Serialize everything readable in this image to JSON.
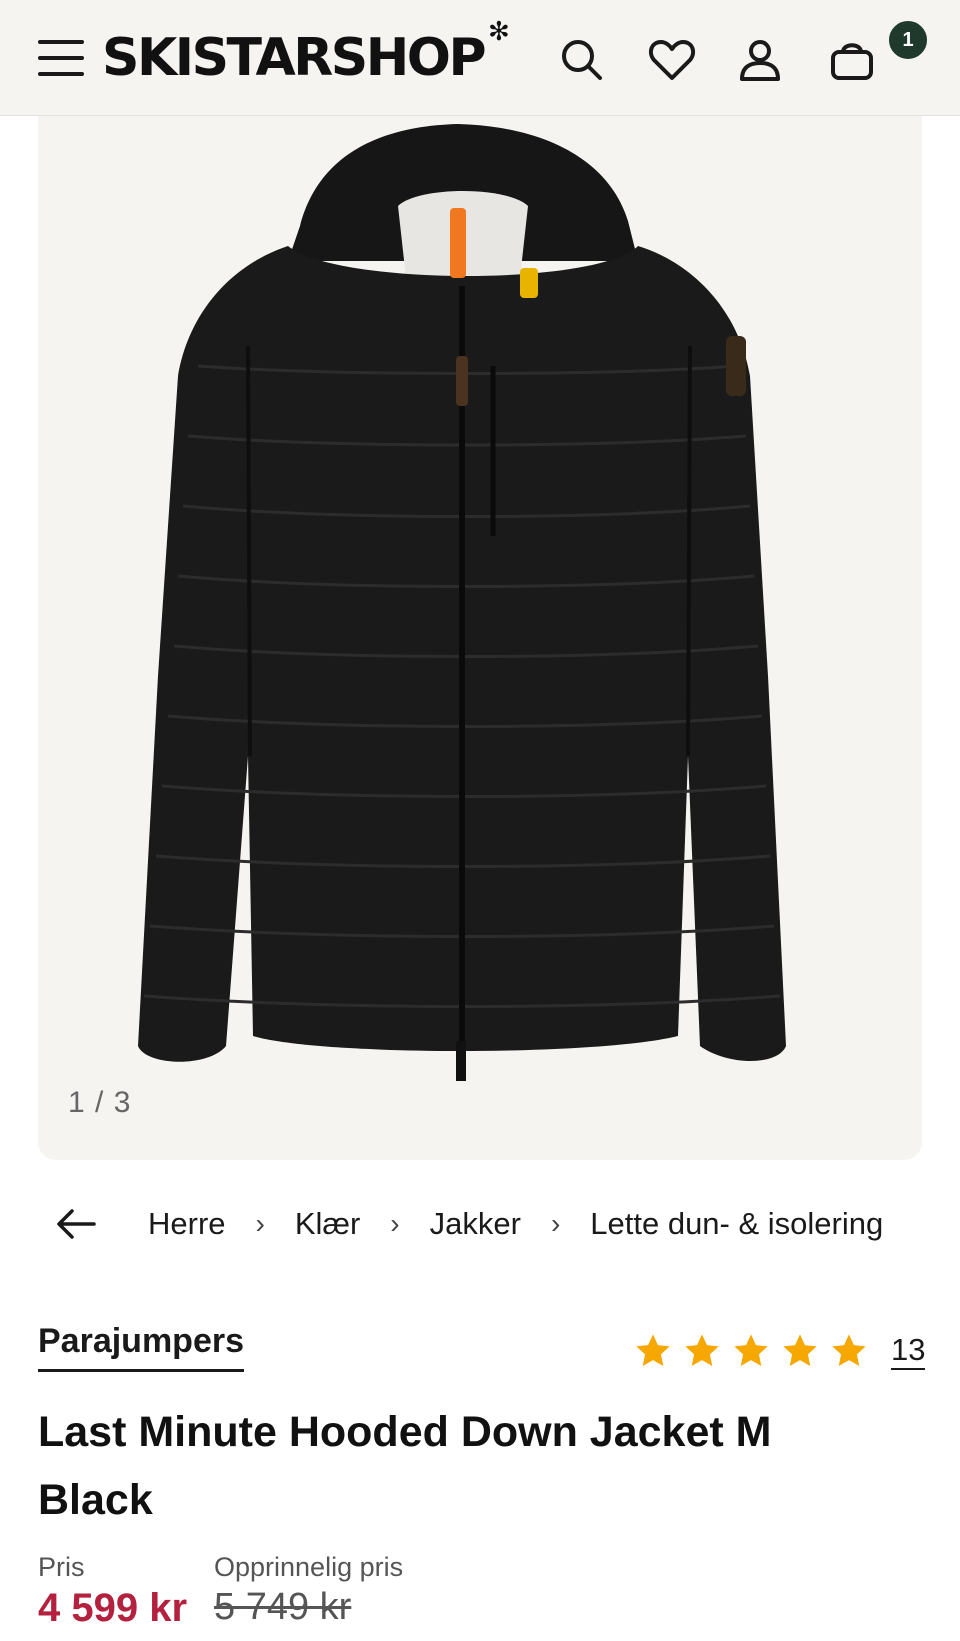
{
  "header": {
    "logo": "SKISTARSHOP",
    "cart_count": "1"
  },
  "gallery": {
    "counter": "1 / 3"
  },
  "breadcrumb": {
    "items": [
      "Herre",
      "Klær",
      "Jakker",
      "Lette dun- & isolering"
    ]
  },
  "product": {
    "brand": "Parajumpers",
    "rating": 5,
    "review_count": "13",
    "title": "Last Minute Hooded Down Jacket M Black",
    "price_label": "Pris",
    "price": "4 599 kr",
    "original_price_label": "Opprinnelig pris",
    "original_price": "5 749 kr"
  },
  "colors": {
    "header_bg": "#f5f4f0",
    "badge": "#1f3a2c",
    "price": "#b3213f",
    "star": "#f6a800"
  }
}
